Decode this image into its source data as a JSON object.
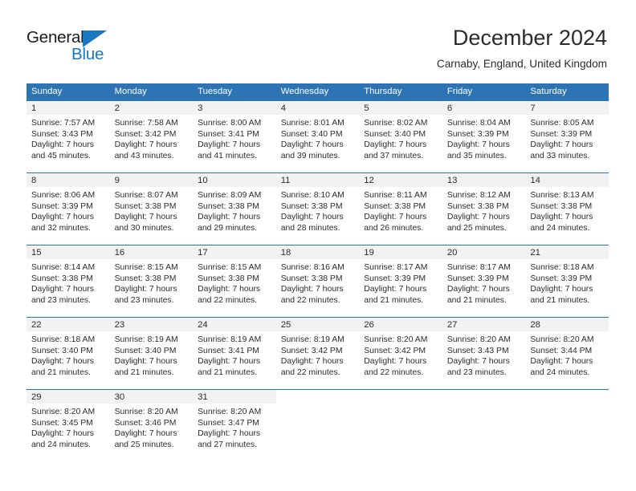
{
  "brand": {
    "name_primary": "General",
    "name_secondary": "Blue",
    "triangle_icon": "triangle-icon",
    "accent_color": "#1878c0"
  },
  "header": {
    "month_title": "December 2024",
    "location": "Carnaby, England, United Kingdom"
  },
  "theme": {
    "header_row_bg": "#2e74b5",
    "daynum_band_bg": "#f2f2f2",
    "text_color": "#2b2b2b"
  },
  "calendar": {
    "weekday_headers": [
      "Sunday",
      "Monday",
      "Tuesday",
      "Wednesday",
      "Thursday",
      "Friday",
      "Saturday"
    ],
    "weeks": [
      [
        {
          "day": "1",
          "sunrise": "Sunrise: 7:57 AM",
          "sunset": "Sunset: 3:43 PM",
          "daylight_line1": "Daylight: 7 hours",
          "daylight_line2": "and 45 minutes."
        },
        {
          "day": "2",
          "sunrise": "Sunrise: 7:58 AM",
          "sunset": "Sunset: 3:42 PM",
          "daylight_line1": "Daylight: 7 hours",
          "daylight_line2": "and 43 minutes."
        },
        {
          "day": "3",
          "sunrise": "Sunrise: 8:00 AM",
          "sunset": "Sunset: 3:41 PM",
          "daylight_line1": "Daylight: 7 hours",
          "daylight_line2": "and 41 minutes."
        },
        {
          "day": "4",
          "sunrise": "Sunrise: 8:01 AM",
          "sunset": "Sunset: 3:40 PM",
          "daylight_line1": "Daylight: 7 hours",
          "daylight_line2": "and 39 minutes."
        },
        {
          "day": "5",
          "sunrise": "Sunrise: 8:02 AM",
          "sunset": "Sunset: 3:40 PM",
          "daylight_line1": "Daylight: 7 hours",
          "daylight_line2": "and 37 minutes."
        },
        {
          "day": "6",
          "sunrise": "Sunrise: 8:04 AM",
          "sunset": "Sunset: 3:39 PM",
          "daylight_line1": "Daylight: 7 hours",
          "daylight_line2": "and 35 minutes."
        },
        {
          "day": "7",
          "sunrise": "Sunrise: 8:05 AM",
          "sunset": "Sunset: 3:39 PM",
          "daylight_line1": "Daylight: 7 hours",
          "daylight_line2": "and 33 minutes."
        }
      ],
      [
        {
          "day": "8",
          "sunrise": "Sunrise: 8:06 AM",
          "sunset": "Sunset: 3:39 PM",
          "daylight_line1": "Daylight: 7 hours",
          "daylight_line2": "and 32 minutes."
        },
        {
          "day": "9",
          "sunrise": "Sunrise: 8:07 AM",
          "sunset": "Sunset: 3:38 PM",
          "daylight_line1": "Daylight: 7 hours",
          "daylight_line2": "and 30 minutes."
        },
        {
          "day": "10",
          "sunrise": "Sunrise: 8:09 AM",
          "sunset": "Sunset: 3:38 PM",
          "daylight_line1": "Daylight: 7 hours",
          "daylight_line2": "and 29 minutes."
        },
        {
          "day": "11",
          "sunrise": "Sunrise: 8:10 AM",
          "sunset": "Sunset: 3:38 PM",
          "daylight_line1": "Daylight: 7 hours",
          "daylight_line2": "and 28 minutes."
        },
        {
          "day": "12",
          "sunrise": "Sunrise: 8:11 AM",
          "sunset": "Sunset: 3:38 PM",
          "daylight_line1": "Daylight: 7 hours",
          "daylight_line2": "and 26 minutes."
        },
        {
          "day": "13",
          "sunrise": "Sunrise: 8:12 AM",
          "sunset": "Sunset: 3:38 PM",
          "daylight_line1": "Daylight: 7 hours",
          "daylight_line2": "and 25 minutes."
        },
        {
          "day": "14",
          "sunrise": "Sunrise: 8:13 AM",
          "sunset": "Sunset: 3:38 PM",
          "daylight_line1": "Daylight: 7 hours",
          "daylight_line2": "and 24 minutes."
        }
      ],
      [
        {
          "day": "15",
          "sunrise": "Sunrise: 8:14 AM",
          "sunset": "Sunset: 3:38 PM",
          "daylight_line1": "Daylight: 7 hours",
          "daylight_line2": "and 23 minutes."
        },
        {
          "day": "16",
          "sunrise": "Sunrise: 8:15 AM",
          "sunset": "Sunset: 3:38 PM",
          "daylight_line1": "Daylight: 7 hours",
          "daylight_line2": "and 23 minutes."
        },
        {
          "day": "17",
          "sunrise": "Sunrise: 8:15 AM",
          "sunset": "Sunset: 3:38 PM",
          "daylight_line1": "Daylight: 7 hours",
          "daylight_line2": "and 22 minutes."
        },
        {
          "day": "18",
          "sunrise": "Sunrise: 8:16 AM",
          "sunset": "Sunset: 3:38 PM",
          "daylight_line1": "Daylight: 7 hours",
          "daylight_line2": "and 22 minutes."
        },
        {
          "day": "19",
          "sunrise": "Sunrise: 8:17 AM",
          "sunset": "Sunset: 3:39 PM",
          "daylight_line1": "Daylight: 7 hours",
          "daylight_line2": "and 21 minutes."
        },
        {
          "day": "20",
          "sunrise": "Sunrise: 8:17 AM",
          "sunset": "Sunset: 3:39 PM",
          "daylight_line1": "Daylight: 7 hours",
          "daylight_line2": "and 21 minutes."
        },
        {
          "day": "21",
          "sunrise": "Sunrise: 8:18 AM",
          "sunset": "Sunset: 3:39 PM",
          "daylight_line1": "Daylight: 7 hours",
          "daylight_line2": "and 21 minutes."
        }
      ],
      [
        {
          "day": "22",
          "sunrise": "Sunrise: 8:18 AM",
          "sunset": "Sunset: 3:40 PM",
          "daylight_line1": "Daylight: 7 hours",
          "daylight_line2": "and 21 minutes."
        },
        {
          "day": "23",
          "sunrise": "Sunrise: 8:19 AM",
          "sunset": "Sunset: 3:40 PM",
          "daylight_line1": "Daylight: 7 hours",
          "daylight_line2": "and 21 minutes."
        },
        {
          "day": "24",
          "sunrise": "Sunrise: 8:19 AM",
          "sunset": "Sunset: 3:41 PM",
          "daylight_line1": "Daylight: 7 hours",
          "daylight_line2": "and 21 minutes."
        },
        {
          "day": "25",
          "sunrise": "Sunrise: 8:19 AM",
          "sunset": "Sunset: 3:42 PM",
          "daylight_line1": "Daylight: 7 hours",
          "daylight_line2": "and 22 minutes."
        },
        {
          "day": "26",
          "sunrise": "Sunrise: 8:20 AM",
          "sunset": "Sunset: 3:42 PM",
          "daylight_line1": "Daylight: 7 hours",
          "daylight_line2": "and 22 minutes."
        },
        {
          "day": "27",
          "sunrise": "Sunrise: 8:20 AM",
          "sunset": "Sunset: 3:43 PM",
          "daylight_line1": "Daylight: 7 hours",
          "daylight_line2": "and 23 minutes."
        },
        {
          "day": "28",
          "sunrise": "Sunrise: 8:20 AM",
          "sunset": "Sunset: 3:44 PM",
          "daylight_line1": "Daylight: 7 hours",
          "daylight_line2": "and 24 minutes."
        }
      ],
      [
        {
          "day": "29",
          "sunrise": "Sunrise: 8:20 AM",
          "sunset": "Sunset: 3:45 PM",
          "daylight_line1": "Daylight: 7 hours",
          "daylight_line2": "and 24 minutes."
        },
        {
          "day": "30",
          "sunrise": "Sunrise: 8:20 AM",
          "sunset": "Sunset: 3:46 PM",
          "daylight_line1": "Daylight: 7 hours",
          "daylight_line2": "and 25 minutes."
        },
        {
          "day": "31",
          "sunrise": "Sunrise: 8:20 AM",
          "sunset": "Sunset: 3:47 PM",
          "daylight_line1": "Daylight: 7 hours",
          "daylight_line2": "and 27 minutes."
        },
        {
          "day": "",
          "sunrise": "",
          "sunset": "",
          "daylight_line1": "",
          "daylight_line2": ""
        },
        {
          "day": "",
          "sunrise": "",
          "sunset": "",
          "daylight_line1": "",
          "daylight_line2": ""
        },
        {
          "day": "",
          "sunrise": "",
          "sunset": "",
          "daylight_line1": "",
          "daylight_line2": ""
        },
        {
          "day": "",
          "sunrise": "",
          "sunset": "",
          "daylight_line1": "",
          "daylight_line2": ""
        }
      ]
    ]
  }
}
